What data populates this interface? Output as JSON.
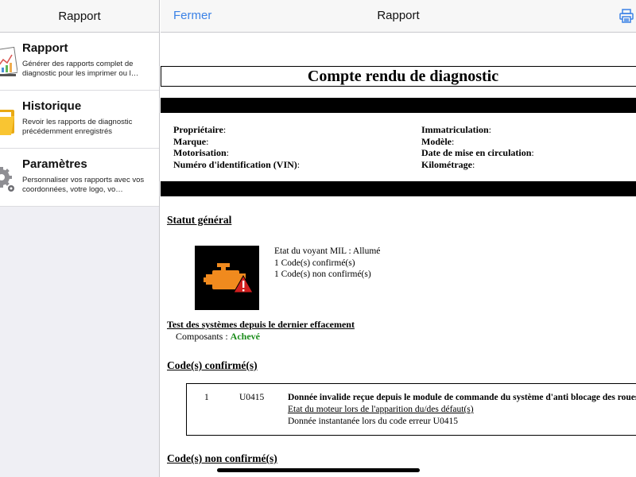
{
  "sidebar": {
    "title": "Rapport",
    "items": [
      {
        "label": "Rapport",
        "desc": "Générer des rapports complet de diagnostic pour les imprimer ou l…",
        "icon": "report-chart-icon"
      },
      {
        "label": "Historique",
        "desc": "Revoir les rapports de diagnostic précédemment enregistrés",
        "icon": "folder-icon"
      },
      {
        "label": "Paramètres",
        "desc": "Personnaliser vos rapports avec vos coordonnées, votre logo, vo…",
        "icon": "gear-icon"
      }
    ]
  },
  "main": {
    "close_label": "Fermer",
    "title": "Rapport",
    "print_icon": "printer-icon"
  },
  "report": {
    "title": "Compte rendu de diagnostic",
    "vehicle": {
      "owner": "Propriétaire",
      "make": "Marque",
      "engine": "Motorisation",
      "vin": "Numéro d'identification (VIN)",
      "registration": "Immatriculation",
      "model": "Modèle",
      "first_registration": "Date de mise en circulation",
      "mileage": "Kilométrage"
    },
    "status": {
      "heading": "Statut général",
      "mil_state": "Etat du voyant MIL : Allumé",
      "confirmed_count": "1 Code(s) confirmé(s)",
      "unconfirmed_count": "1 Code(s) non confirmé(s)",
      "engine_icon": "check-engine-warning-icon"
    },
    "tests": {
      "heading": "Test des systèmes depuis le dernier effacement",
      "components_label": "Composants :",
      "components_value": "Achevé"
    },
    "confirmed": {
      "heading": "Code(s) confirmé(s)",
      "codes": [
        {
          "index": "1",
          "code": "U0415",
          "description": "Donnée invalide reçue depuis le module de commande du système d'anti blocage des roues",
          "engine_state": "Etat du moteur lors de l'apparition du/des défaut(s)",
          "freeze_frame": "Donnée instantanée lors du code erreur U0415"
        }
      ]
    },
    "unconfirmed": {
      "heading": "Code(s) non confirmé(s)"
    }
  },
  "colors": {
    "accent": "#3b82e6",
    "success": "#1a8c1a",
    "engine_orange": "#f08a1e",
    "warning_red": "#d21f1f"
  }
}
